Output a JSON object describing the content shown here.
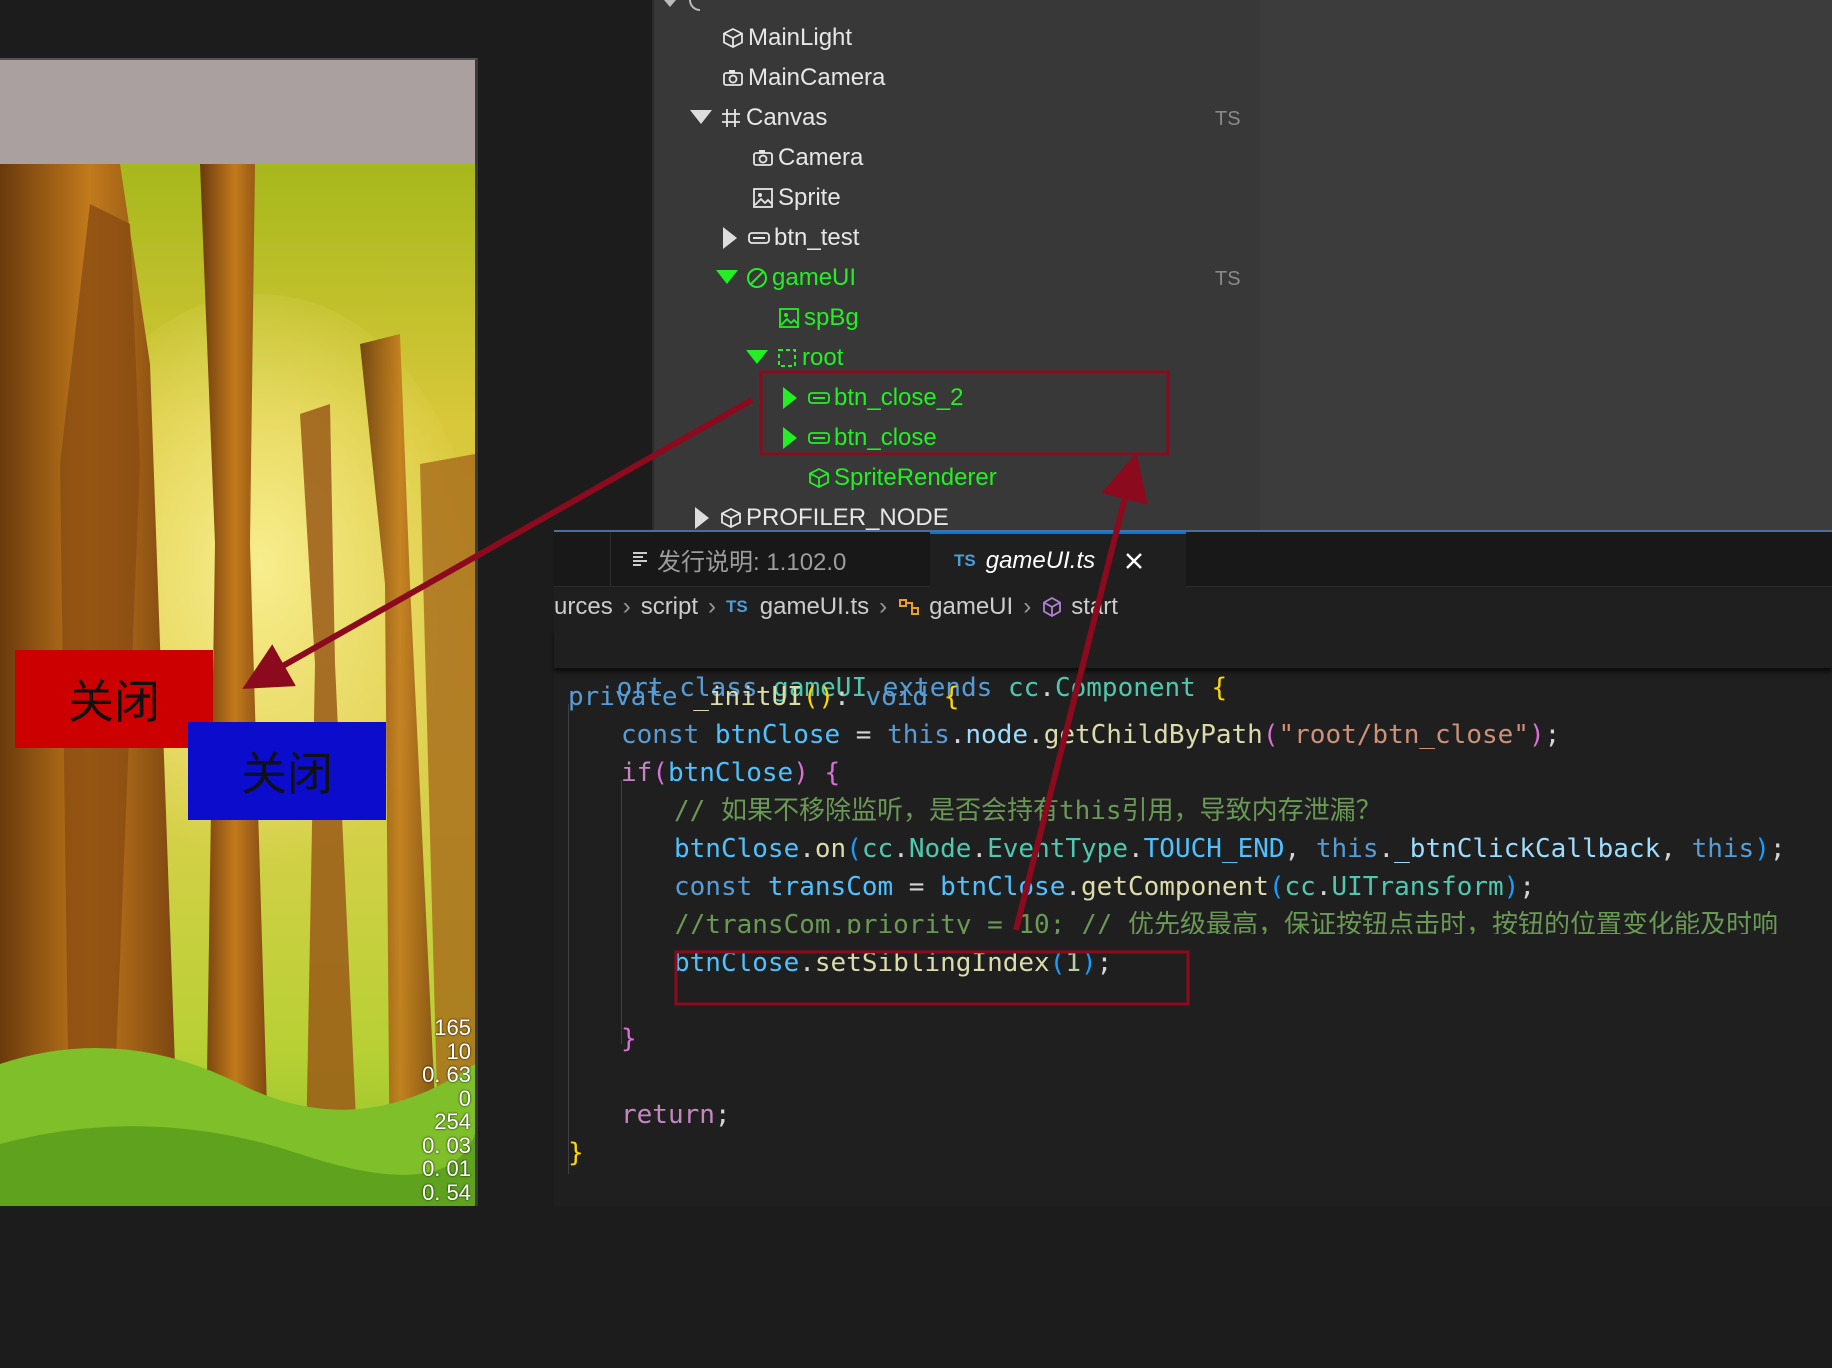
{
  "game_preview": {
    "button_red_label": "关闭",
    "button_blue_label": "关闭",
    "stats": [
      "165",
      "10",
      "0. 63",
      "0",
      "254",
      "0. 03",
      "0. 01",
      "0. 54"
    ]
  },
  "hierarchy": {
    "nodes": [
      {
        "label": "MainLight",
        "icon": "cube-icon"
      },
      {
        "label": "MainCamera",
        "icon": "camera-icon"
      },
      {
        "label": "Canvas",
        "icon": "grid-icon",
        "tag": "TS"
      },
      {
        "label": "Camera",
        "icon": "camera-icon"
      },
      {
        "label": "Sprite",
        "icon": "image-icon"
      },
      {
        "label": "btn_test",
        "icon": "button-icon"
      },
      {
        "label": "gameUI",
        "icon": "slash-circle-icon",
        "tag": "TS"
      },
      {
        "label": "spBg",
        "icon": "image-icon"
      },
      {
        "label": "root",
        "icon": "dashed-rect-icon"
      },
      {
        "label": "btn_close_2",
        "icon": "button-icon"
      },
      {
        "label": "btn_close",
        "icon": "button-icon"
      },
      {
        "label": "SpriteRenderer",
        "icon": "cube-icon"
      },
      {
        "label": "PROFILER_NODE",
        "icon": "cube-icon"
      }
    ]
  },
  "editor": {
    "tabs": [
      {
        "label": "发行说明: 1.102.0",
        "icon": "list-icon"
      },
      {
        "label": "gameUI.ts",
        "icon": "ts-icon",
        "badge": "TS"
      }
    ],
    "breadcrumb": [
      "urces",
      "script",
      "gameUI.ts",
      "gameUI",
      "start"
    ],
    "breadcrumb_ts_badge": "TS",
    "sticky_line": {
      "a": "ort ",
      "b": "class ",
      "c": "gameUI ",
      "d": "extends ",
      "e": "cc",
      "f": ".",
      "g": "Component",
      "h": " {"
    },
    "code": {
      "l1_kw": "private ",
      "l1_fn": "_initUI",
      "l1_p": "()",
      "l1_colon": ": ",
      "l1_ty": "void",
      "l1_sp": " ",
      "l1_br": "{",
      "l2_kw": "const ",
      "l2_var": "btnClose",
      "l2_eq": " = ",
      "l2_this": "this",
      "l2_dot": ".",
      "l2_node": "node",
      "l2_dot2": ".",
      "l2_fn": "getChildByPath",
      "l2_p1": "(",
      "l2_str": "\"root/btn_close\"",
      "l2_p2": ")",
      "l2_end": ";",
      "l3_if": "if",
      "l3_p1": "(",
      "l3_var": "btnClose",
      "l3_p2": ")",
      "l3_sp": " ",
      "l3_br": "{",
      "l4_cm": "// 如果不移除监听，是否会持有this引用，导致内存泄漏？",
      "l5_var": "btnClose",
      "l5_dot": ".",
      "l5_fn": "on",
      "l5_p1": "(",
      "l5_cc": "cc",
      "l5_d1": ".",
      "l5_node": "Node",
      "l5_d2": ".",
      "l5_et": "EventType",
      "l5_d3": ".",
      "l5_te": "TOUCH_END",
      "l5_c1": ", ",
      "l5_this": "this",
      "l5_d4": ".",
      "l5_cb": "_btnClickCallback",
      "l5_c2": ", ",
      "l5_this2": "this",
      "l5_p2": ")",
      "l5_end": ";",
      "l6_kw": "const ",
      "l6_var": "transCom",
      "l6_eq": " = ",
      "l6_bc": "btnClose",
      "l6_dot": ".",
      "l6_fn": "getComponent",
      "l6_p1": "(",
      "l6_cc": "cc",
      "l6_d": ".",
      "l6_ty": "UITransform",
      "l6_p2": ")",
      "l6_end": ";",
      "l7_cm": "//transCom.priority = 10; // 优先级最高，保证按钮点击时，按钮的位置变化能及时响",
      "l8_var": "btnClose",
      "l8_dot": ".",
      "l8_fn": "setSiblingIndex",
      "l8_p1": "(",
      "l8_num": "1",
      "l8_p2": ")",
      "l8_end": ";",
      "l9_br": "}",
      "l10_ret": "return",
      "l10_end": ";",
      "l11_br": "}"
    }
  },
  "colors": {
    "annotation": "#8b0a1e",
    "selected_node": "#22f022",
    "tab_accent": "#0078d4"
  }
}
